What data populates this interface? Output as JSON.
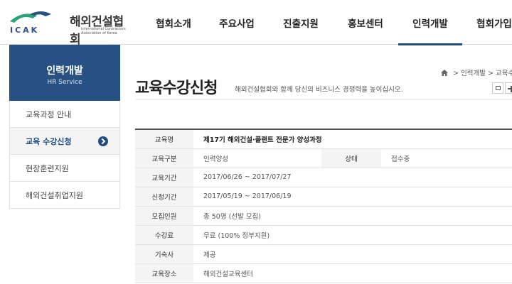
{
  "header": {
    "logo_title": "해외건설협회",
    "logo_abbr": "ICAK",
    "logo_sub": "International Contractors Association of Korea",
    "nav": [
      {
        "label": "협회소개"
      },
      {
        "label": "주요사업"
      },
      {
        "label": "진출지원"
      },
      {
        "label": "홍보센터"
      },
      {
        "label": "인력개발"
      },
      {
        "label": "협회가입"
      }
    ],
    "active_index": 4
  },
  "sidebar": {
    "title": "인력개발",
    "subtitle": "HR Service",
    "items": [
      {
        "label": "교육과정 안내"
      },
      {
        "label": "교육 수강신청"
      },
      {
        "label": "현장훈련지원"
      },
      {
        "label": "해외건설취업지원"
      }
    ],
    "active_index": 1
  },
  "page": {
    "title": "교육수강신청",
    "description": "해외건설협회와 함께 당신의 비즈니스 경쟁력을 높이십시오.",
    "breadcrumb": [
      "인력개발",
      "교육수강"
    ],
    "breadcrumb_sep": ">"
  },
  "course": {
    "name_label": "교육명",
    "name_value": "제17기 해외건설·플랜트 전문가 양성과정",
    "category_label": "교육구분",
    "category_value": "인력양성",
    "status_label": "상태",
    "status_value": "접수중",
    "period_label": "교육기간",
    "period_value": "2017/06/26 ~ 2017/07/27",
    "apply_label": "신청기간",
    "apply_value": "2017/05/19 ~ 2017/06/19",
    "recruit_label": "모집인원",
    "recruit_value": "총 50명 (선발 모집)",
    "fee_label": "수강료",
    "fee_value": "무료 (100% 정부지원)",
    "dorm_label": "기숙사",
    "dorm_value": "제공",
    "place_label": "교육장소",
    "place_value": "해외건설교육센터"
  },
  "colors": {
    "brand_blue": "#285183",
    "brand_green": "#2aa37a"
  }
}
